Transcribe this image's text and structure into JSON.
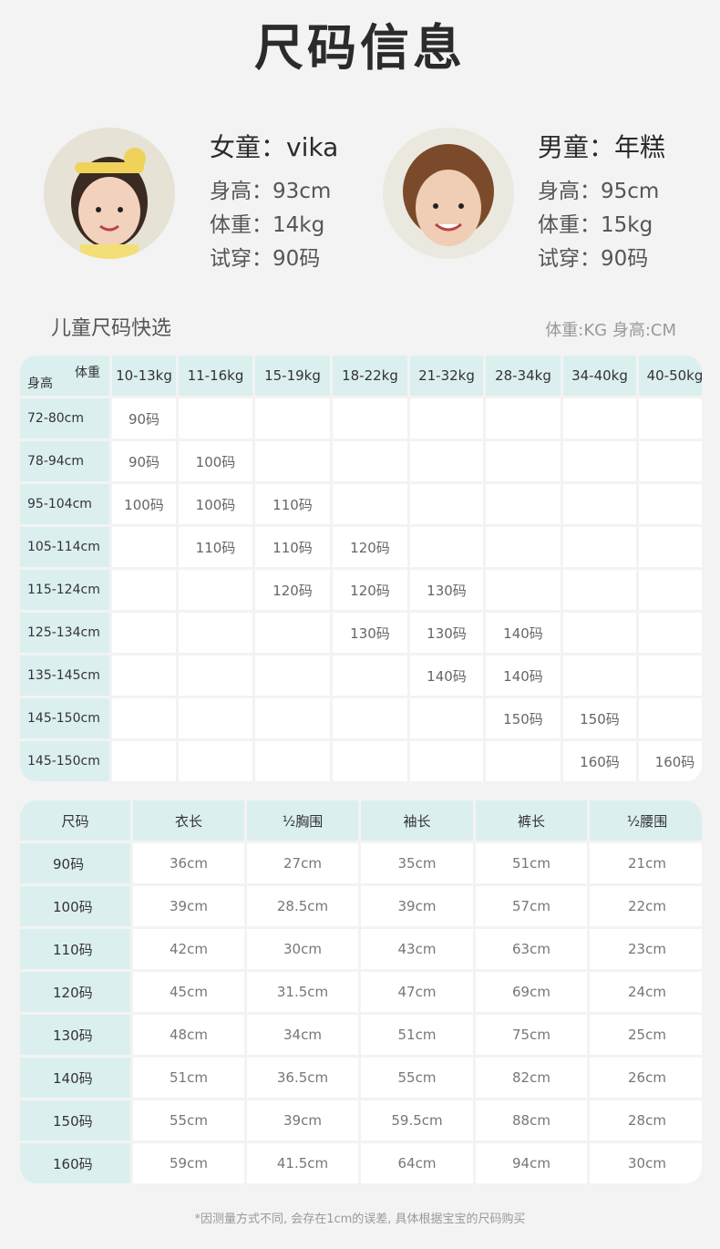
{
  "title": "尺码信息",
  "models": [
    {
      "name": "女童：vika",
      "height": "身高：93cm",
      "weight": "体重：14kg",
      "try": "试穿：90码"
    },
    {
      "name": "男童：年糕",
      "height": "身高：95cm",
      "weight": "体重：15kg",
      "try": "试穿：90码"
    }
  ],
  "quick": {
    "title": "儿童尺码快选",
    "unit": "体重:KG  身高:CM",
    "corner_weight": "体重",
    "corner_height": "身高",
    "weights": [
      "10-13kg",
      "11-16kg",
      "15-19kg",
      "18-22kg",
      "21-32kg",
      "28-34kg",
      "34-40kg",
      "40-50kg"
    ],
    "rows": [
      {
        "h": "72-80cm",
        "v": [
          "90码",
          "",
          "",
          "",
          "",
          "",
          "",
          ""
        ]
      },
      {
        "h": "78-94cm",
        "v": [
          "90码",
          "100码",
          "",
          "",
          "",
          "",
          "",
          ""
        ]
      },
      {
        "h": "95-104cm",
        "v": [
          "100码",
          "100码",
          "110码",
          "",
          "",
          "",
          "",
          ""
        ]
      },
      {
        "h": "105-114cm",
        "v": [
          "",
          "110码",
          "110码",
          "120码",
          "",
          "",
          "",
          ""
        ]
      },
      {
        "h": "115-124cm",
        "v": [
          "",
          "",
          "120码",
          "120码",
          "130码",
          "",
          "",
          ""
        ]
      },
      {
        "h": "125-134cm",
        "v": [
          "",
          "",
          "",
          "130码",
          "130码",
          "140码",
          "",
          ""
        ]
      },
      {
        "h": "135-145cm",
        "v": [
          "",
          "",
          "",
          "",
          "140码",
          "140码",
          "",
          ""
        ]
      },
      {
        "h": "145-150cm",
        "v": [
          "",
          "",
          "",
          "",
          "",
          "150码",
          "150码",
          ""
        ]
      },
      {
        "h": "145-150cm",
        "v": [
          "",
          "",
          "",
          "",
          "",
          "",
          "160码",
          "160码"
        ]
      }
    ]
  },
  "sizes": {
    "headers": [
      "尺码",
      "衣长",
      "½胸围",
      "袖长",
      "裤长",
      "½腰围"
    ],
    "rows": [
      [
        "90码",
        "36cm",
        "27cm",
        "35cm",
        "51cm",
        "21cm"
      ],
      [
        "100码",
        "39cm",
        "28.5cm",
        "39cm",
        "57cm",
        "22cm"
      ],
      [
        "110码",
        "42cm",
        "30cm",
        "43cm",
        "63cm",
        "23cm"
      ],
      [
        "120码",
        "45cm",
        "31.5cm",
        "47cm",
        "69cm",
        "24cm"
      ],
      [
        "130码",
        "48cm",
        "34cm",
        "51cm",
        "75cm",
        "25cm"
      ],
      [
        "140码",
        "51cm",
        "36.5cm",
        "55cm",
        "82cm",
        "26cm"
      ],
      [
        "150码",
        "55cm",
        "39cm",
        "59.5cm",
        "88cm",
        "28cm"
      ],
      [
        "160码",
        "59cm",
        "41.5cm",
        "64cm",
        "94cm",
        "30cm"
      ]
    ]
  },
  "note": "*因测量方式不同, 会存在1cm的误差, 具体根据宝宝的尺码购买"
}
